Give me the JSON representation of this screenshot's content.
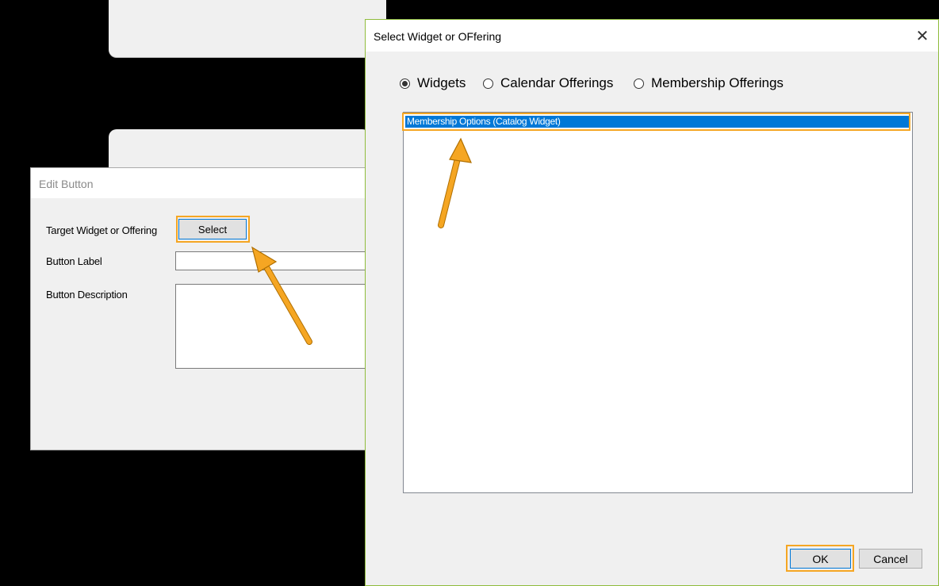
{
  "edit_dialog": {
    "title": "Edit Button",
    "target_label": "Target Widget or Offering",
    "select_button_label": "Select",
    "button_label_label": "Button Label",
    "button_label_value": "",
    "button_description_label": "Button Description",
    "button_description_value": ""
  },
  "select_dialog": {
    "title": "Select Widget or OFfering",
    "close_glyph": "✕",
    "radio_options": [
      {
        "label": "Widgets",
        "selected": true
      },
      {
        "label": "Calendar Offerings",
        "selected": false
      },
      {
        "label": "Membership Offerings",
        "selected": false
      }
    ],
    "list_items": [
      "Membership Options (Catalog Widget)"
    ],
    "selected_index": 0,
    "ok_label": "OK",
    "cancel_label": "Cancel"
  },
  "colors": {
    "annotation": "#f5a623",
    "selection": "#0078d7",
    "dialog_bg": "#f0f0f0",
    "screen_bg": "#000000"
  }
}
